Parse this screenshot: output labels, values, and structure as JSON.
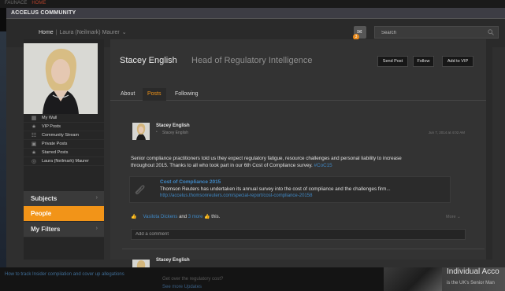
{
  "background": {
    "top_text": "FAUNACE",
    "top_link": "HOME",
    "bottom_link": "How to track Insider compilation and cover up allegations",
    "bottom_snippet": "Get over the regulatory cost?",
    "bottom_more": "See more Updates",
    "side_panel_title": "Individual Acco",
    "side_panel_sub": "is the UK's Senior Man"
  },
  "window": {
    "title": "ACCELUS COMMUNITY"
  },
  "breadcrumb": {
    "home": "Home",
    "current": "Laura (Neilmark) Maurer"
  },
  "notifications": {
    "count": "3"
  },
  "search": {
    "placeholder": "Search"
  },
  "sidebar": {
    "items": [
      {
        "label": "My Wall",
        "icon": "wall-icon"
      },
      {
        "label": "VIP Posts",
        "icon": "star-icon"
      },
      {
        "label": "Community Stream",
        "icon": "stream-icon"
      },
      {
        "label": "Private Posts",
        "icon": "lock-icon"
      },
      {
        "label": "Starred Posts",
        "icon": "star-icon"
      },
      {
        "label": "Laura (Neilmark) Maurer",
        "icon": "user-icon"
      }
    ],
    "sections": [
      {
        "label": "Subjects",
        "active": false
      },
      {
        "label": "People",
        "active": true
      },
      {
        "label": "My Filters",
        "active": false
      }
    ]
  },
  "profile": {
    "name": "Stacey English",
    "title": "Head of Regulatory Intelligence",
    "buttons": {
      "send_post": "Send Post",
      "follow": "Follow",
      "add_vip": "Add to VIP"
    }
  },
  "tabs": [
    "About",
    "Posts",
    "Following"
  ],
  "active_tab": "Posts",
  "post": {
    "author": "Stacey English",
    "handle": "Stacey English",
    "date": "Jun 7, 2014 at 4:02 AM",
    "text_line1": "Senior compliance practitioners told us they expect regulatory fatigue, resource challenges and personal liability to increase",
    "text_line2": "throughout 2015. Thanks to all who took part in our 6th Cost of Compliance survey.",
    "hashtag": "#CoC15",
    "link": {
      "title": "Cost of Compliance 2015",
      "description": "Thomson Reuters has undertaken its annual survey into the cost of compliance and the challenges firm...",
      "url": "http://accelus.thomsonreuters.com/special-report/cost-compliance-20158"
    },
    "likes": {
      "name": "Vasilota Dickens",
      "and": "and",
      "more": "3 more",
      "suffix": "this."
    },
    "more_menu": "More",
    "comment_placeholder": "Add a comment"
  },
  "next_post": {
    "author": "Stacey English"
  },
  "colors": {
    "accent": "#f29418",
    "link": "#3f88c5",
    "panel": "#333333"
  }
}
